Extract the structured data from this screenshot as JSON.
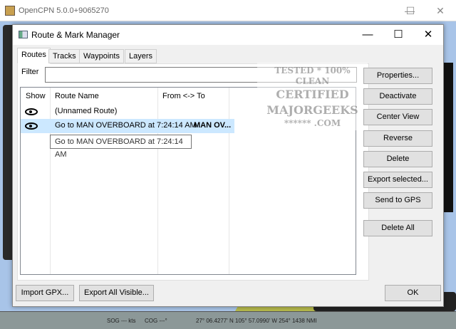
{
  "app": {
    "title": "OpenCPN 5.0.0+9065270"
  },
  "dialog": {
    "title": "Route & Mark Manager",
    "tabs": [
      "Routes",
      "Tracks",
      "Waypoints",
      "Layers"
    ],
    "filter_label": "Filter",
    "filter_value": "",
    "columns": [
      "Show",
      "Route Name",
      "From <-> To"
    ],
    "routes": [
      {
        "name": "(Unnamed Route)",
        "from_to": "",
        "visible": true
      },
      {
        "name": "Go to MAN OVERBOARD at 7:24:14 AM",
        "from_to": "MAN OV...",
        "visible": true,
        "selected": true
      }
    ],
    "tooltip": "Go to MAN OVERBOARD at 7:24:14 AM",
    "side_buttons": [
      "Properties...",
      "Deactivate",
      "Center View",
      "Reverse",
      "Delete",
      "Export selected...",
      "Send to GPS",
      "Delete All"
    ],
    "import_gpx": "Import GPX...",
    "export_all": "Export All Visible...",
    "ok": "OK"
  },
  "watermark": {
    "lines": [
      "TESTED * 100% CLEAN",
      "CERTIFIED",
      "MAJORGEEKS",
      "****** .COM"
    ]
  },
  "status": {
    "sog": "SOG --- kts",
    "cog": "COG ---°",
    "position": "27° 06.4277' N  105° 57.0990' W  254°  1438 NMI"
  }
}
